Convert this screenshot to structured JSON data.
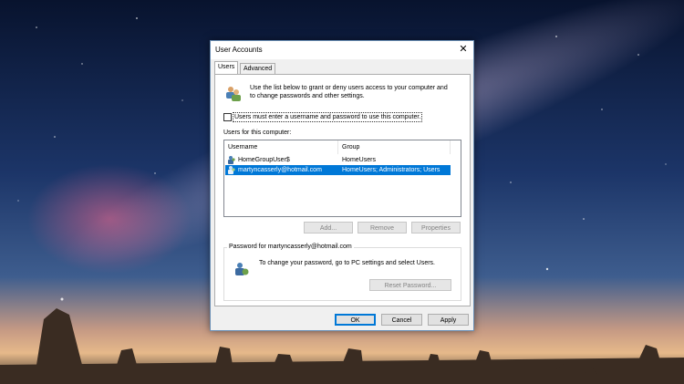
{
  "dialog": {
    "title": "User Accounts",
    "close_glyph": "✕",
    "tabs": [
      {
        "label": "Users",
        "active": true
      },
      {
        "label": "Advanced",
        "active": false
      }
    ],
    "intro_line1": "Use the list below to grant or deny users access to your computer and",
    "intro_line2": "to change passwords and other settings.",
    "checkbox": {
      "label": "Users must enter a username and password to use this computer.",
      "checked": false
    },
    "list_label": "Users for this computer:",
    "columns": [
      "Username",
      "Group"
    ],
    "users": [
      {
        "username": "HomeGroupUser$",
        "group": "HomeUsers",
        "selected": false
      },
      {
        "username": "martyncasserly@hotmail.com",
        "group": "HomeUsers; Administrators; Users",
        "selected": true
      }
    ],
    "list_buttons": {
      "add": "Add...",
      "remove": "Remove",
      "properties": "Properties"
    },
    "password_group": {
      "label": "Password for martyncasserly@hotmail.com",
      "text": "To change your password, go to PC settings and select Users.",
      "reset_button": "Reset Password..."
    },
    "footer_buttons": {
      "ok": "OK",
      "cancel": "Cancel",
      "apply": "Apply"
    }
  },
  "colors": {
    "accent": "#0078d7",
    "sky_top": "#0a1a3a",
    "sky_horizon": "#e0a070"
  },
  "icons": [
    "users-icon",
    "user-icon",
    "close-icon"
  ]
}
